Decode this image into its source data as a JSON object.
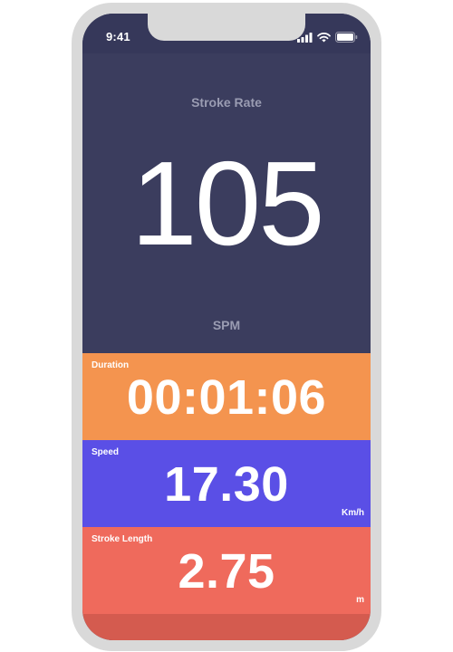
{
  "status_bar": {
    "time": "9:41",
    "icons": [
      "signal-icon",
      "wifi-icon",
      "battery-icon"
    ]
  },
  "stroke_rate": {
    "title": "Stroke Rate",
    "value": "105",
    "unit": "SPM"
  },
  "metrics": {
    "duration": {
      "label": "Duration",
      "value": "00:01:06",
      "unit": ""
    },
    "speed": {
      "label": "Speed",
      "value": "17.30",
      "unit": "Km/h"
    },
    "stroke_length": {
      "label": "Stroke Length",
      "value": "2.75",
      "unit": "m"
    }
  },
  "colors": {
    "hero_background": "#3b3d5e",
    "status_background": "#36385a",
    "duration_background": "#f4944f",
    "speed_background": "#5a4fe6",
    "stroke_length_background": "#ef6a5c",
    "footer_background": "#d45b4f",
    "device_frame": "#d9d9d9"
  }
}
